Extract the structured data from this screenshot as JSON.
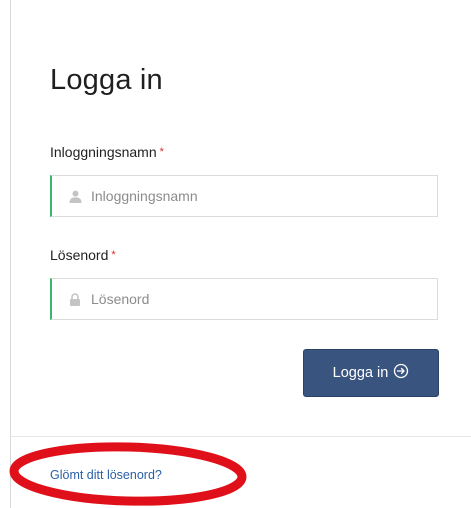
{
  "login": {
    "title": "Logga in",
    "username": {
      "label": "Inloggningsnamn",
      "required_marker": "*",
      "placeholder": "Inloggningsnamn",
      "value": "",
      "icon": "user-icon"
    },
    "password": {
      "label": "Lösenord",
      "required_marker": "*",
      "placeholder": "Lösenord",
      "value": "",
      "icon": "lock-icon"
    },
    "submit": {
      "label": "Logga in",
      "icon": "arrow-circle-right-icon"
    },
    "forgot_link": "Glömt ditt lösenord?"
  },
  "colors": {
    "button_bg": "#3a5480",
    "field_accent": "#3fb26b",
    "required": "#d9262a",
    "link": "#2b5fa6",
    "annotation": "#e0101a"
  }
}
